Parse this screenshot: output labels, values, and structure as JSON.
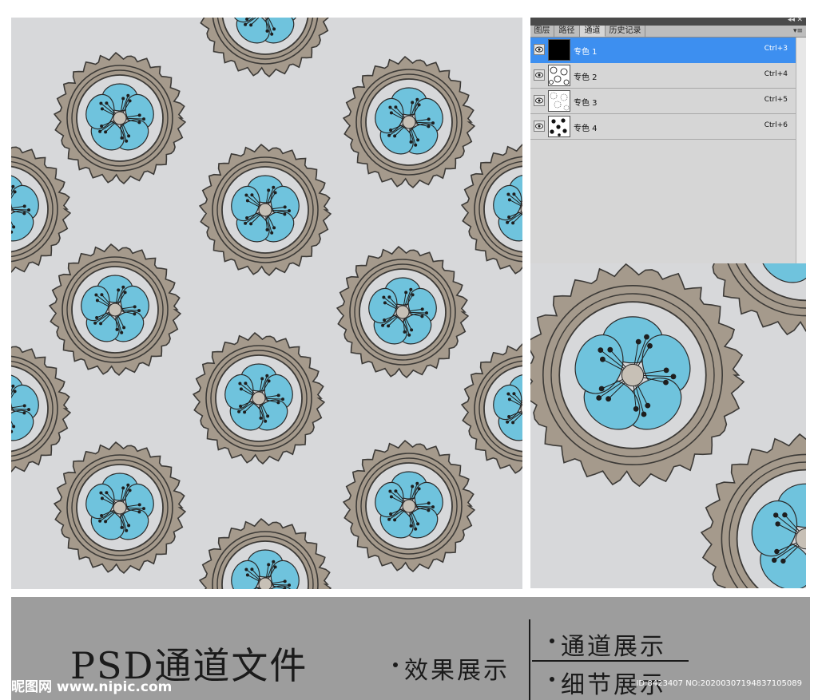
{
  "panel": {
    "tabs": [
      "图层",
      "路径",
      "通道",
      "历史记录"
    ],
    "active_tab": "通道",
    "collapse_icon": "double-chevron-icon",
    "close_icon": "close-icon",
    "menu_icon": "panel-menu-icon",
    "channels": [
      {
        "name": "专色 1",
        "shortcut": "Ctrl+3",
        "selected": true
      },
      {
        "name": "专色 2",
        "shortcut": "Ctrl+4",
        "selected": false
      },
      {
        "name": "专色 3",
        "shortcut": "Ctrl+5",
        "selected": false
      },
      {
        "name": "专色 4",
        "shortcut": "Ctrl+6",
        "selected": false
      }
    ],
    "selected_color": "#3d8ff0"
  },
  "colors": {
    "background": "#d7d8da",
    "ring": "#a59a8c",
    "ring_outline": "#3c3a37",
    "petal": "#6fc3dd",
    "banner": "#9d9d9d"
  },
  "banner": {
    "title": "PSD通道文件",
    "effect": "效果展示",
    "channel": "通道展示",
    "detail": "细节展示"
  },
  "watermark": {
    "site": "昵图网 www.nipic.com",
    "id": "ID:8423407 NO:20200307194837105089"
  }
}
